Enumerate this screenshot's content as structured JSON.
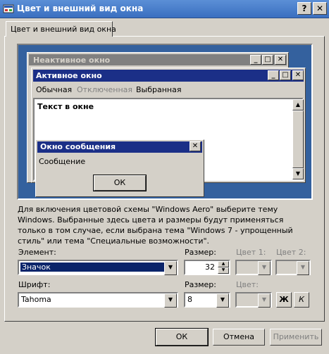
{
  "window": {
    "title": "Цвет и внешний вид окна",
    "help": "?",
    "close": "✕"
  },
  "tabs": [
    {
      "label": "Цвет и внешний вид окна"
    }
  ],
  "preview": {
    "inactive_title": "Неактивное окно",
    "active_title": "Активное окно",
    "menu": [
      "Обычная",
      "Отключенная",
      "Выбранная"
    ],
    "window_text": "Текст в окне",
    "message_title": "Окно сообщения",
    "message_text": "Сообщение",
    "ok_label": "ОК"
  },
  "description": "Для включения цветовой схемы \"Windows Aero\" выберите тему Windows. Выбранные здесь цвета и размеры будут применяться только в том случае, если выбрана тема \"Windows 7 - упрощенный стиль\" или тема \"Специальные возможности\".",
  "element": {
    "label": "Элемент:",
    "value": "Значок"
  },
  "size1": {
    "label": "Размер:",
    "value": "32"
  },
  "color1": {
    "label": "Цвет 1:"
  },
  "color2": {
    "label": "Цвет 2:"
  },
  "font": {
    "label": "Шрифт:",
    "value": "Tahoma"
  },
  "size2": {
    "label": "Размер:",
    "value": "8"
  },
  "color3": {
    "label": "Цвет:"
  },
  "bold_label": "Ж",
  "italic_label": "К",
  "buttons": {
    "ok": "ОК",
    "cancel": "Отмена",
    "apply": "Применить"
  }
}
